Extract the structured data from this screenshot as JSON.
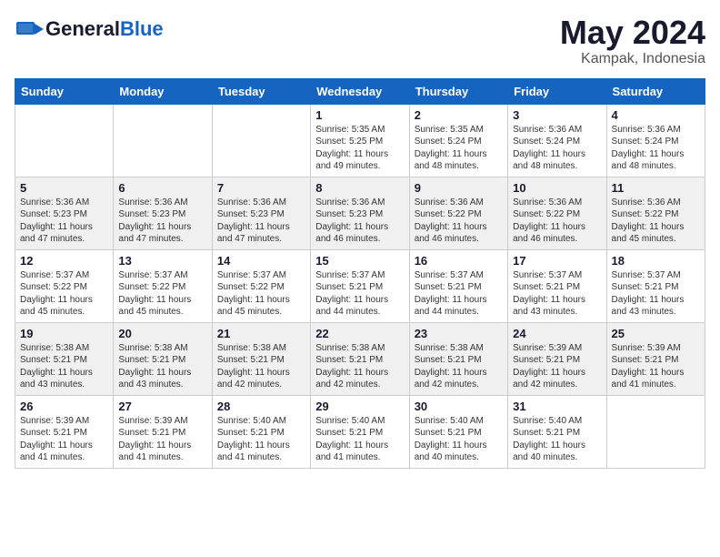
{
  "header": {
    "logo_general": "General",
    "logo_blue": "Blue",
    "month": "May 2024",
    "location": "Kampak, Indonesia"
  },
  "weekdays": [
    "Sunday",
    "Monday",
    "Tuesday",
    "Wednesday",
    "Thursday",
    "Friday",
    "Saturday"
  ],
  "weeks": [
    [
      {
        "day": "",
        "info": ""
      },
      {
        "day": "",
        "info": ""
      },
      {
        "day": "",
        "info": ""
      },
      {
        "day": "1",
        "info": "Sunrise: 5:35 AM\nSunset: 5:25 PM\nDaylight: 11 hours\nand 49 minutes."
      },
      {
        "day": "2",
        "info": "Sunrise: 5:35 AM\nSunset: 5:24 PM\nDaylight: 11 hours\nand 48 minutes."
      },
      {
        "day": "3",
        "info": "Sunrise: 5:36 AM\nSunset: 5:24 PM\nDaylight: 11 hours\nand 48 minutes."
      },
      {
        "day": "4",
        "info": "Sunrise: 5:36 AM\nSunset: 5:24 PM\nDaylight: 11 hours\nand 48 minutes."
      }
    ],
    [
      {
        "day": "5",
        "info": "Sunrise: 5:36 AM\nSunset: 5:23 PM\nDaylight: 11 hours\nand 47 minutes."
      },
      {
        "day": "6",
        "info": "Sunrise: 5:36 AM\nSunset: 5:23 PM\nDaylight: 11 hours\nand 47 minutes."
      },
      {
        "day": "7",
        "info": "Sunrise: 5:36 AM\nSunset: 5:23 PM\nDaylight: 11 hours\nand 47 minutes."
      },
      {
        "day": "8",
        "info": "Sunrise: 5:36 AM\nSunset: 5:23 PM\nDaylight: 11 hours\nand 46 minutes."
      },
      {
        "day": "9",
        "info": "Sunrise: 5:36 AM\nSunset: 5:22 PM\nDaylight: 11 hours\nand 46 minutes."
      },
      {
        "day": "10",
        "info": "Sunrise: 5:36 AM\nSunset: 5:22 PM\nDaylight: 11 hours\nand 46 minutes."
      },
      {
        "day": "11",
        "info": "Sunrise: 5:36 AM\nSunset: 5:22 PM\nDaylight: 11 hours\nand 45 minutes."
      }
    ],
    [
      {
        "day": "12",
        "info": "Sunrise: 5:37 AM\nSunset: 5:22 PM\nDaylight: 11 hours\nand 45 minutes."
      },
      {
        "day": "13",
        "info": "Sunrise: 5:37 AM\nSunset: 5:22 PM\nDaylight: 11 hours\nand 45 minutes."
      },
      {
        "day": "14",
        "info": "Sunrise: 5:37 AM\nSunset: 5:22 PM\nDaylight: 11 hours\nand 45 minutes."
      },
      {
        "day": "15",
        "info": "Sunrise: 5:37 AM\nSunset: 5:21 PM\nDaylight: 11 hours\nand 44 minutes."
      },
      {
        "day": "16",
        "info": "Sunrise: 5:37 AM\nSunset: 5:21 PM\nDaylight: 11 hours\nand 44 minutes."
      },
      {
        "day": "17",
        "info": "Sunrise: 5:37 AM\nSunset: 5:21 PM\nDaylight: 11 hours\nand 43 minutes."
      },
      {
        "day": "18",
        "info": "Sunrise: 5:37 AM\nSunset: 5:21 PM\nDaylight: 11 hours\nand 43 minutes."
      }
    ],
    [
      {
        "day": "19",
        "info": "Sunrise: 5:38 AM\nSunset: 5:21 PM\nDaylight: 11 hours\nand 43 minutes."
      },
      {
        "day": "20",
        "info": "Sunrise: 5:38 AM\nSunset: 5:21 PM\nDaylight: 11 hours\nand 43 minutes."
      },
      {
        "day": "21",
        "info": "Sunrise: 5:38 AM\nSunset: 5:21 PM\nDaylight: 11 hours\nand 42 minutes."
      },
      {
        "day": "22",
        "info": "Sunrise: 5:38 AM\nSunset: 5:21 PM\nDaylight: 11 hours\nand 42 minutes."
      },
      {
        "day": "23",
        "info": "Sunrise: 5:38 AM\nSunset: 5:21 PM\nDaylight: 11 hours\nand 42 minutes."
      },
      {
        "day": "24",
        "info": "Sunrise: 5:39 AM\nSunset: 5:21 PM\nDaylight: 11 hours\nand 42 minutes."
      },
      {
        "day": "25",
        "info": "Sunrise: 5:39 AM\nSunset: 5:21 PM\nDaylight: 11 hours\nand 41 minutes."
      }
    ],
    [
      {
        "day": "26",
        "info": "Sunrise: 5:39 AM\nSunset: 5:21 PM\nDaylight: 11 hours\nand 41 minutes."
      },
      {
        "day": "27",
        "info": "Sunrise: 5:39 AM\nSunset: 5:21 PM\nDaylight: 11 hours\nand 41 minutes."
      },
      {
        "day": "28",
        "info": "Sunrise: 5:40 AM\nSunset: 5:21 PM\nDaylight: 11 hours\nand 41 minutes."
      },
      {
        "day": "29",
        "info": "Sunrise: 5:40 AM\nSunset: 5:21 PM\nDaylight: 11 hours\nand 41 minutes."
      },
      {
        "day": "30",
        "info": "Sunrise: 5:40 AM\nSunset: 5:21 PM\nDaylight: 11 hours\nand 40 minutes."
      },
      {
        "day": "31",
        "info": "Sunrise: 5:40 AM\nSunset: 5:21 PM\nDaylight: 11 hours\nand 40 minutes."
      },
      {
        "day": "",
        "info": ""
      }
    ]
  ]
}
